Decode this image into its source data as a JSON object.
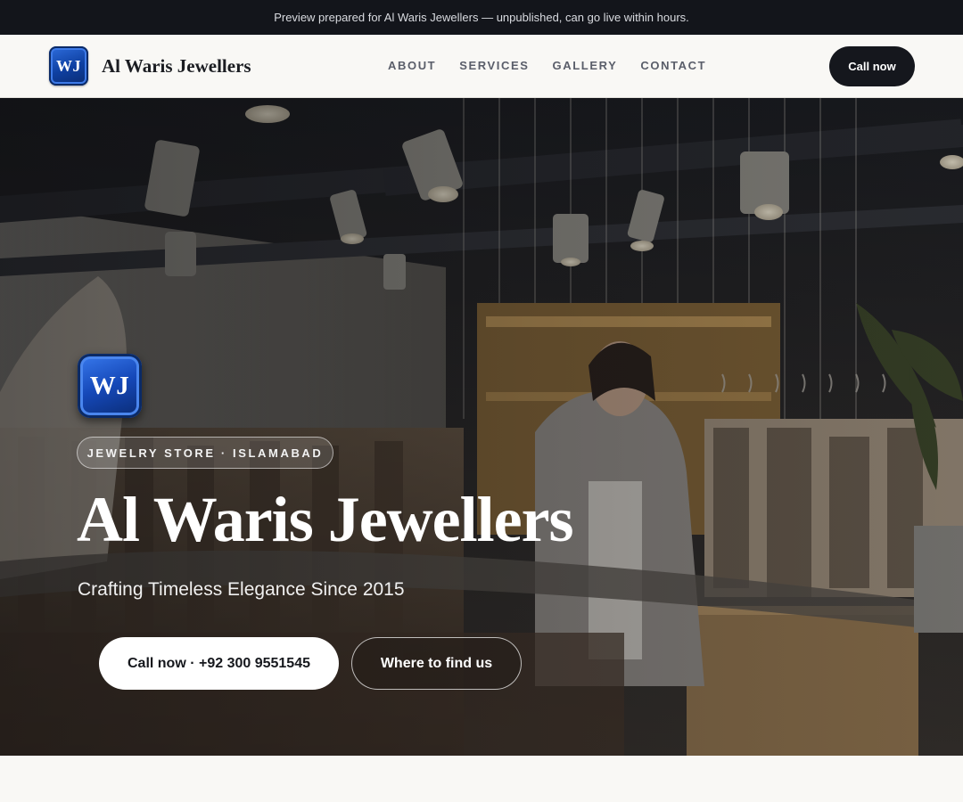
{
  "banner": {
    "text": "Preview prepared for Al Waris Jewellers — unpublished, can go live within hours."
  },
  "header": {
    "logo_initials": "WJ",
    "brand_name": "Al Waris Jewellers",
    "nav": [
      {
        "label": "ABOUT"
      },
      {
        "label": "SERVICES"
      },
      {
        "label": "GALLERY"
      },
      {
        "label": "CONTACT"
      }
    ],
    "cta_label": "Call now"
  },
  "hero": {
    "logo_initials": "WJ",
    "eyebrow": "JEWELRY STORE · ISLAMABAD",
    "title": "Al Waris Jewellers",
    "subtitle": "Crafting Timeless Elegance Since 2015",
    "primary_button": "Call now · +92 300 9551545",
    "secondary_button": "Where to find us"
  },
  "colors": {
    "banner_bg": "#13151b",
    "header_bg": "#f9f8f5",
    "cta_bg": "#15171d",
    "logo_blue": "#1548b8",
    "page_bg": "#f9f8f5"
  }
}
